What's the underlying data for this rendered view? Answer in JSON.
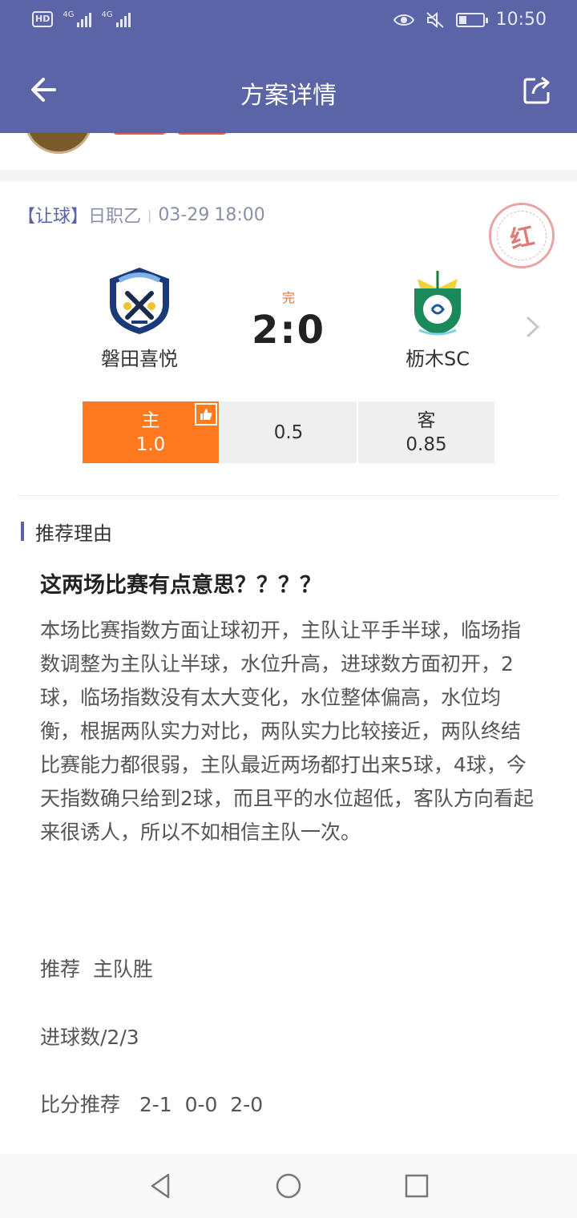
{
  "status_bar": {
    "hd": "HD",
    "signal1_label": "4G",
    "signal2_label": "4G",
    "time": "10:50"
  },
  "header": {
    "title": "方案详情",
    "back_icon": "back-arrow-icon",
    "share_icon": "share-icon",
    "color": "#5a64a6"
  },
  "match": {
    "type": "【让球】",
    "league": "日职乙",
    "date": "03-29",
    "time": "18:00",
    "result_stamp": "红",
    "status": "完",
    "score": "2:0",
    "home": {
      "name": "磐田喜悦",
      "logo": "jubilo-iwata-crest-icon"
    },
    "away": {
      "name": "枥木SC",
      "logo": "tochigi-sc-crest-icon"
    }
  },
  "odds": {
    "home_label": "主",
    "home_value": "1.0",
    "handicap": "0.5",
    "away_label": "客",
    "away_value": "0.85",
    "selected": "home",
    "accent": "#ff7a1f"
  },
  "reason": {
    "section_title": "推荐理由",
    "headline": "这两场比赛有点意思？？？？",
    "body": "本场比赛指数方面让球初开，主队让平手半球，临场指数调整为主队让半球，水位升高，进球数方面初开，2球，临场指数没有太大变化，水位整体偏高，水位均衡，根据两队实力对比，两队实力比较接近，两队终结比赛能力都很弱，主队最近两场都打出来5球，4球，今天指数确只给到2球，而且平的水位超低，客队方向看起来很诱人，所以不如相信主队一次。",
    "recommend": "推荐  主队胜",
    "goals": "进球数/2/3",
    "scores": "比分推荐   2-1  0-0  2-0"
  },
  "nav": {
    "back": "triangle-back-icon",
    "home": "circle-home-icon",
    "recent": "square-recent-icon"
  }
}
